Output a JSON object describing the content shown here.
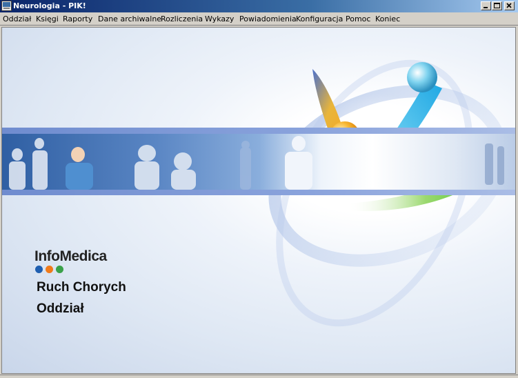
{
  "window": {
    "title": "Neurologia - PIK!",
    "controls": [
      "minimize",
      "maximize",
      "close"
    ]
  },
  "menu": [
    {
      "label": "Oddział"
    },
    {
      "label": "Księgi"
    },
    {
      "label": "Raporty"
    },
    {
      "label": "Dane archiwalne"
    },
    {
      "label": "Rozliczenia"
    },
    {
      "label": "Wykazy"
    },
    {
      "label": "Powiadomienia"
    },
    {
      "label": "Konfiguracja"
    },
    {
      "label": "Pomoc"
    },
    {
      "label": "Koniec"
    }
  ],
  "splash": {
    "logo_text": "InfoMedica",
    "logo_dot_colors": [
      "#1f5fb0",
      "#f07a1a",
      "#3aa14a"
    ],
    "module_name": "Ruch Chorych",
    "module_subtitle": "Oddział"
  },
  "colors": {
    "titlebar_start": "#0a246a",
    "titlebar_end": "#a6caf0",
    "band": "#7a96d4",
    "orb_orange": "#f5a623",
    "orb_cyan": "#29b6e8",
    "orb_green": "#58c93a"
  }
}
